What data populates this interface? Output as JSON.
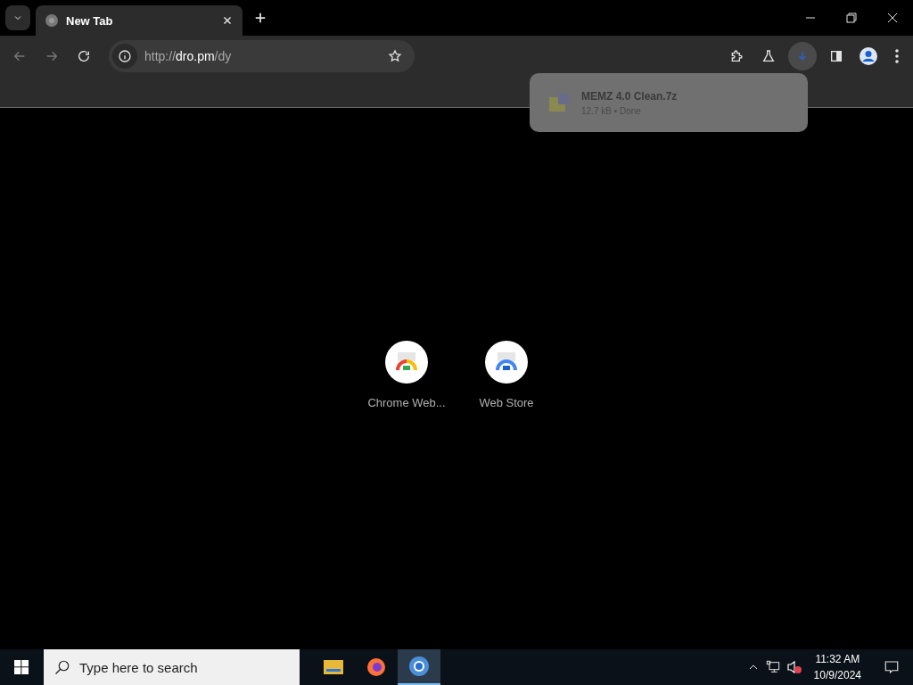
{
  "tabs": [
    {
      "title": "New Tab",
      "selected": true
    }
  ],
  "address_bar": {
    "scheme": "http://",
    "host": "dro.pm",
    "path": "/dy"
  },
  "download_bubble": {
    "file_name": "MEMZ 4.0 Clean.7z",
    "status": "12.7 kB • Done"
  },
  "shortcuts": [
    {
      "label": "Chrome Web...",
      "kind": "color"
    },
    {
      "label": "Web Store",
      "kind": "blue"
    }
  ],
  "taskbar": {
    "search_placeholder": "Type here to search",
    "apps": [
      {
        "kind": "files",
        "selected": false
      },
      {
        "kind": "firefox",
        "selected": false
      },
      {
        "kind": "chrome",
        "selected": true
      }
    ],
    "time": "11:32 AM",
    "date": "10/9/2024"
  }
}
